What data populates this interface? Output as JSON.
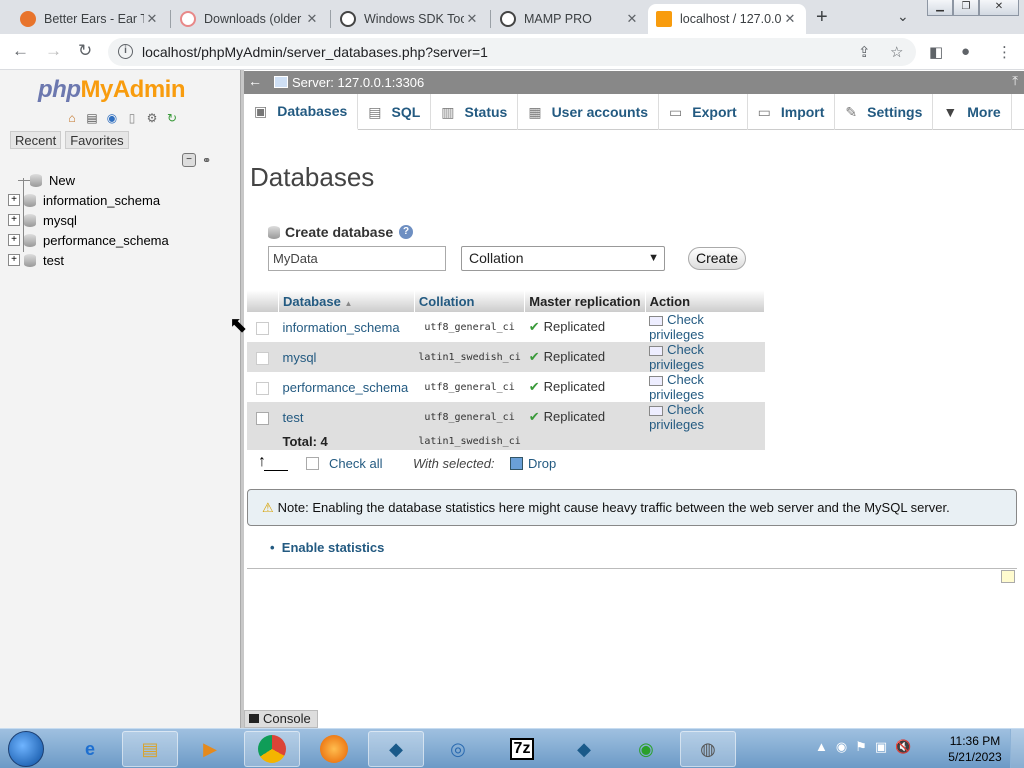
{
  "browser": {
    "tabs": [
      {
        "title": "Better Ears - Ear Tr",
        "icon": "better-ears-icon",
        "color": "#e8742c"
      },
      {
        "title": "Downloads (older",
        "icon": "mamp-icon",
        "color": "#e88888"
      },
      {
        "title": "Windows SDK Too",
        "icon": "globe-icon",
        "color": "#444444"
      },
      {
        "title": "MAMP PRO",
        "icon": "globe-icon",
        "color": "#444444"
      },
      {
        "title": "localhost / 127.0.0",
        "icon": "phpmyadmin-icon",
        "color": "#f89c0e",
        "active": true
      }
    ],
    "url": "localhost/phpMyAdmin/server_databases.php?server=1"
  },
  "sidebar": {
    "logo_php": "php",
    "logo_myadmin": "MyAdmin",
    "tabs": [
      "Recent",
      "Favorites"
    ],
    "tree": [
      "New",
      "information_schema",
      "mysql",
      "performance_schema",
      "test"
    ]
  },
  "serverbar": {
    "label": "Server: 127.0.0.1:3306"
  },
  "menu": [
    {
      "label": "Databases",
      "icon": "database-icon"
    },
    {
      "label": "SQL",
      "icon": "sql-icon"
    },
    {
      "label": "Status",
      "icon": "status-icon"
    },
    {
      "label": "User accounts",
      "icon": "users-icon"
    },
    {
      "label": "Export",
      "icon": "export-icon"
    },
    {
      "label": "Import",
      "icon": "import-icon"
    },
    {
      "label": "Settings",
      "icon": "settings-icon"
    },
    {
      "label": "More",
      "icon": "chevron-down-icon"
    }
  ],
  "main": {
    "title": "Databases",
    "create_label": "Create database",
    "dbname_value": "MyData",
    "collation_value": "Collation",
    "create_button": "Create",
    "table": {
      "headers": [
        "Database",
        "Collation",
        "Master replication",
        "Action"
      ],
      "rows": [
        {
          "name": "information_schema",
          "collation": "utf8_general_ci",
          "replication": "Replicated",
          "action": "Check privileges"
        },
        {
          "name": "mysql",
          "collation": "latin1_swedish_ci",
          "replication": "Replicated",
          "action": "Check privileges"
        },
        {
          "name": "performance_schema",
          "collation": "utf8_general_ci",
          "replication": "Replicated",
          "action": "Check privileges"
        },
        {
          "name": "test",
          "collation": "utf8_general_ci",
          "replication": "Replicated",
          "action": "Check privileges"
        }
      ],
      "total_label": "Total: 4",
      "total_collation": "latin1_swedish_ci"
    },
    "check_all": "Check all",
    "with_selected": "With selected:",
    "drop": "Drop",
    "notice": "Note: Enabling the database statistics here might cause heavy traffic between the web server and the MySQL server.",
    "enable_stats": "Enable statistics",
    "console": "Console"
  },
  "taskbar": {
    "time": "11:36 PM",
    "date": "5/21/2023",
    "apps": [
      "Internet Explorer",
      "Windows Explorer",
      "Media Player",
      "Chrome",
      "Firefox",
      "MySQL Workbench",
      "Windows SDK",
      "7-Zip",
      "MySQL",
      "Network",
      "MAMP PRO"
    ],
    "seven_zip_label": "7z"
  }
}
